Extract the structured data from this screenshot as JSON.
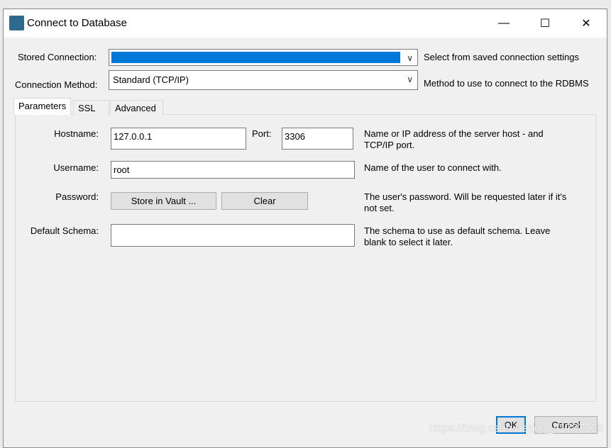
{
  "window": {
    "title": "Connect to Database",
    "minimize_icon": "minimize-icon",
    "maximize_icon": "maximize-icon",
    "close_icon": "close-icon"
  },
  "stored_connection": {
    "label": "Stored Connection:",
    "value": "",
    "hint": "Select from saved connection settings"
  },
  "connection_method": {
    "label": "Connection Method:",
    "value": "Standard (TCP/IP)",
    "hint": "Method to use to connect to the RDBMS"
  },
  "tabs": [
    {
      "label": "Parameters",
      "active": true
    },
    {
      "label": "SSL"
    },
    {
      "label": "Advanced"
    }
  ],
  "params": {
    "hostname": {
      "label": "Hostname:",
      "value": "127.0.0.1"
    },
    "port": {
      "label": "Port:",
      "value": "3306"
    },
    "host_hint": "Name or IP address of the server host - and TCP/IP port.",
    "username": {
      "label": "Username:",
      "value": "root",
      "hint": "Name of the user to connect with."
    },
    "password": {
      "label": "Password:",
      "store_button": "Store in Vault ...",
      "clear_button": "Clear",
      "hint": "The user's password. Will be requested later if it's not set."
    },
    "schema": {
      "label": "Default Schema:",
      "value": "",
      "hint": "The schema to use as default schema. Leave blank to select it later."
    }
  },
  "footer": {
    "ok": "OK",
    "cancel": "Cancel"
  },
  "watermark": "https://blog.csdn.net/qq_41737128",
  "colors": {
    "accent": "#0078d7"
  }
}
